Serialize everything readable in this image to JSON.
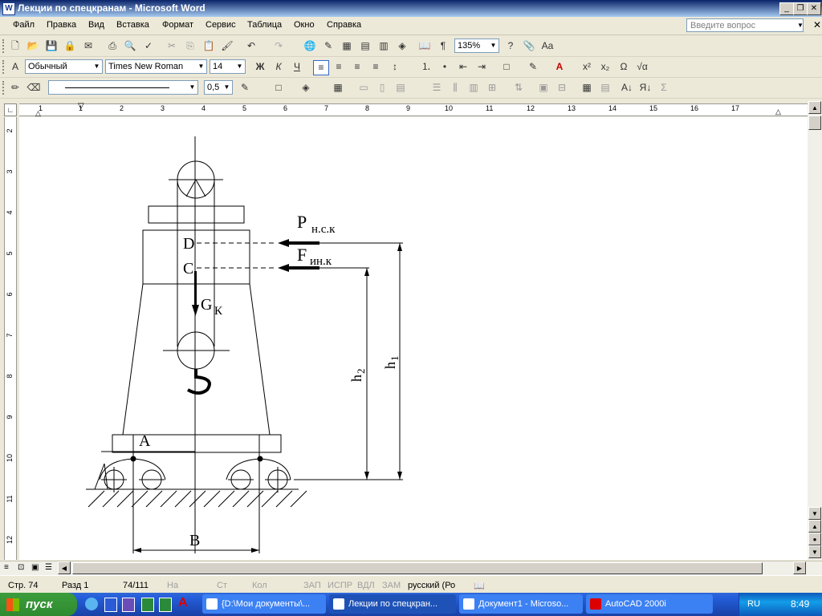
{
  "window": {
    "title": "Лекции по спецкранам - Microsoft Word",
    "icon": "W"
  },
  "menu": [
    "Файл",
    "Правка",
    "Вид",
    "Вставка",
    "Формат",
    "Сервис",
    "Таблица",
    "Окно",
    "Справка"
  ],
  "ask": {
    "placeholder": "Введите вопрос"
  },
  "toolbar": {
    "zoom": "135%",
    "style": "Обычный",
    "font": "Times New Roman",
    "size": "14",
    "line_width": "0,5"
  },
  "ruler": {
    "h": [
      "1",
      "1",
      "2",
      "3",
      "4",
      "5",
      "6",
      "7",
      "8",
      "9",
      "10",
      "11",
      "12",
      "13",
      "14",
      "15",
      "16",
      "17"
    ],
    "v": [
      "2",
      "3",
      "4",
      "5",
      "6",
      "7",
      "8",
      "9",
      "10",
      "11",
      "12"
    ]
  },
  "figure": {
    "labels": {
      "P": "P",
      "P_sub": "н.с.к",
      "F": "F",
      "F_sub": "ин.к",
      "D": "D",
      "C": "C",
      "G": "G",
      "G_sub": "К",
      "h1": "h",
      "h1_sub": "1",
      "h2": "h",
      "h2_sub": "2",
      "A": "A",
      "B": "B"
    }
  },
  "status": {
    "page": "Стр. 74",
    "section": "Разд 1",
    "pages": "74/111",
    "at": "На",
    "line": "Ст",
    "col": "Кол",
    "rec": "ЗАП",
    "trk": "ИСПР",
    "ext": "ВДЛ",
    "ovr": "ЗАМ",
    "lang": "русский (Ро"
  },
  "taskbar": {
    "start": "пуск",
    "tasks": [
      "{D:\\Мои документы\\...",
      "Лекции по спецкран...",
      "Документ1 - Microso...",
      "AutoCAD 2000i"
    ],
    "lang": "RU",
    "time": "8:49"
  }
}
